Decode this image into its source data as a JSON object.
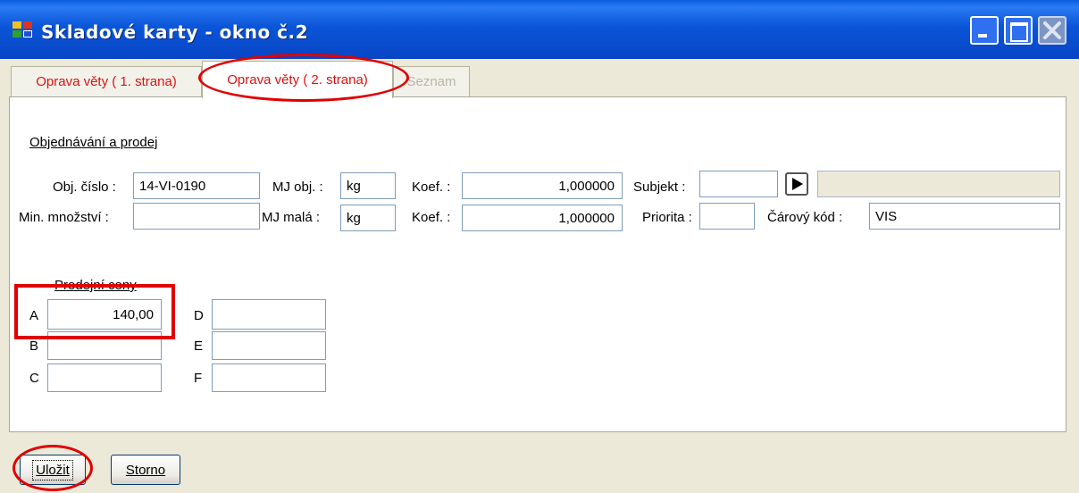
{
  "window": {
    "title": "Skladové karty - okno č.2"
  },
  "tabs": [
    {
      "label": "Oprava věty ( 1. strana)"
    },
    {
      "label": "Oprava věty ( 2. strana)"
    },
    {
      "label": "Seznam"
    }
  ],
  "section": {
    "title": "Objednávání a prodej"
  },
  "order": {
    "obj_cislo_label": "Obj. číslo :",
    "obj_cislo_value": "14-VI-0190",
    "mj_obj_label": "MJ obj. :",
    "mj_obj_value": "kg",
    "koef1_label": "Koef. :",
    "koef1_value": "1,000000",
    "subjekt_label": "Subjekt :",
    "subjekt_value": "",
    "subjekt_name_value": "",
    "min_mnozstvi_label": "Min. množství :",
    "min_mnozstvi_value": "",
    "mj_mala_label": "MJ malá :",
    "mj_mala_value": "kg",
    "koef2_label": "Koef. :",
    "koef2_value": "1,000000",
    "priorita_label": "Priorita :",
    "priorita_value": "",
    "carovy_kod_label": "Čárový kód :",
    "carovy_kod_value": "VIS"
  },
  "prices": {
    "title": "Prodejní ceny",
    "a_label": "A",
    "a_value": "140,00",
    "b_label": "B",
    "b_value": "",
    "c_label": "C",
    "c_value": "",
    "d_label": "D",
    "d_value": "",
    "e_label": "E",
    "e_value": "",
    "f_label": "F",
    "f_value": ""
  },
  "buttons": {
    "save": "Uložit",
    "cancel": "Storno"
  },
  "colors": {
    "titlebar": "#0a55d8",
    "tab_text": "#e01010",
    "highlight": "#e00000"
  }
}
